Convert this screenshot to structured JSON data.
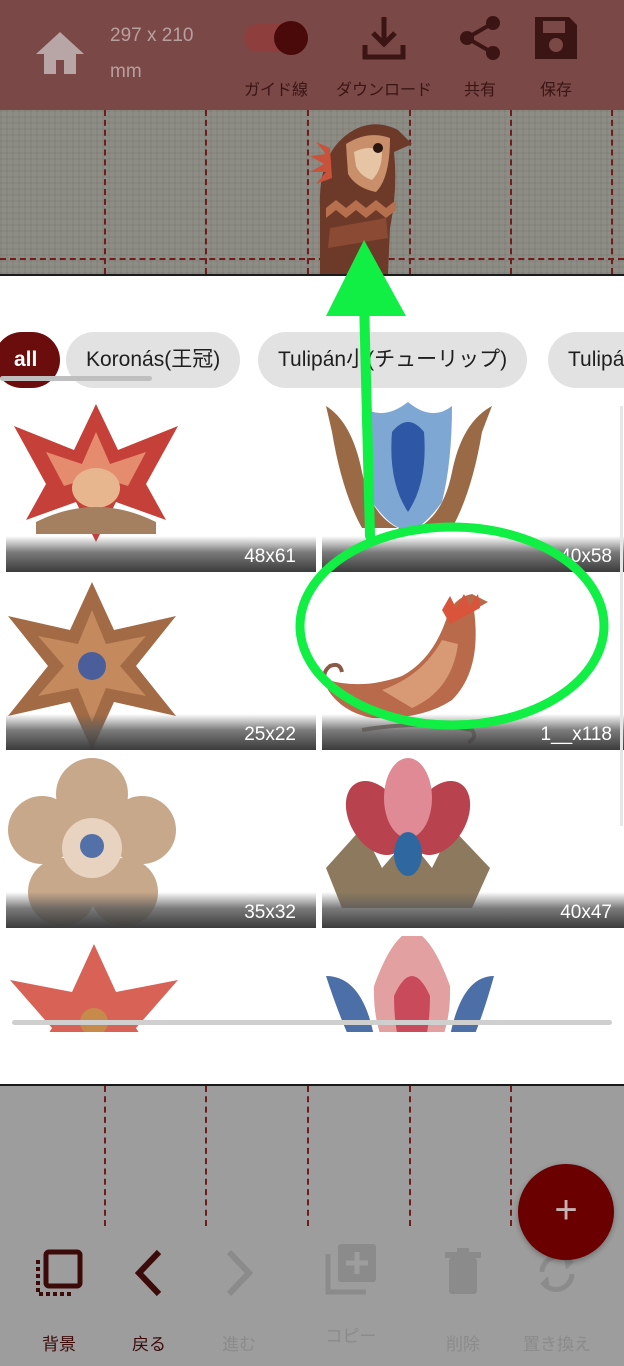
{
  "toolbar": {
    "size_line1": "297 x 210",
    "size_line2": "mm",
    "guide_label": "ガイド線",
    "download_label": "ダウンロード",
    "share_label": "共有",
    "save_label": "保存"
  },
  "categories": [
    {
      "label": "all",
      "active": true
    },
    {
      "label": "Koronás(王冠)",
      "active": false
    },
    {
      "label": "Tulipán小(チューリップ)",
      "active": false
    },
    {
      "label": "Tulipán",
      "active": false
    }
  ],
  "motifs": [
    {
      "size": "48x61",
      "icon": "red-star-flower-icon"
    },
    {
      "size": "40x58",
      "icon": "blue-tulip-icon"
    },
    {
      "size": "25x22",
      "icon": "brown-star-flower-icon"
    },
    {
      "size": "1__x118",
      "icon": "bird-icon"
    },
    {
      "size": "35x32",
      "icon": "beige-flower-icon"
    },
    {
      "size": "40x47",
      "icon": "pink-leaf-flower-icon"
    },
    {
      "size": "",
      "icon": "coral-star-flower-icon"
    },
    {
      "size": "",
      "icon": "pink-blue-tulip-icon"
    }
  ],
  "fab_label": "+",
  "bottom_nav": {
    "background_label": "背景",
    "back_label": "戻る",
    "forward_label": "進む",
    "copy_label": "コピー",
    "delete_label": "削除",
    "replace_label": "置き換え"
  },
  "colors": {
    "brand": "#6b0d0d",
    "toolbar": "#7a4846",
    "annotation": "#11ee44"
  }
}
